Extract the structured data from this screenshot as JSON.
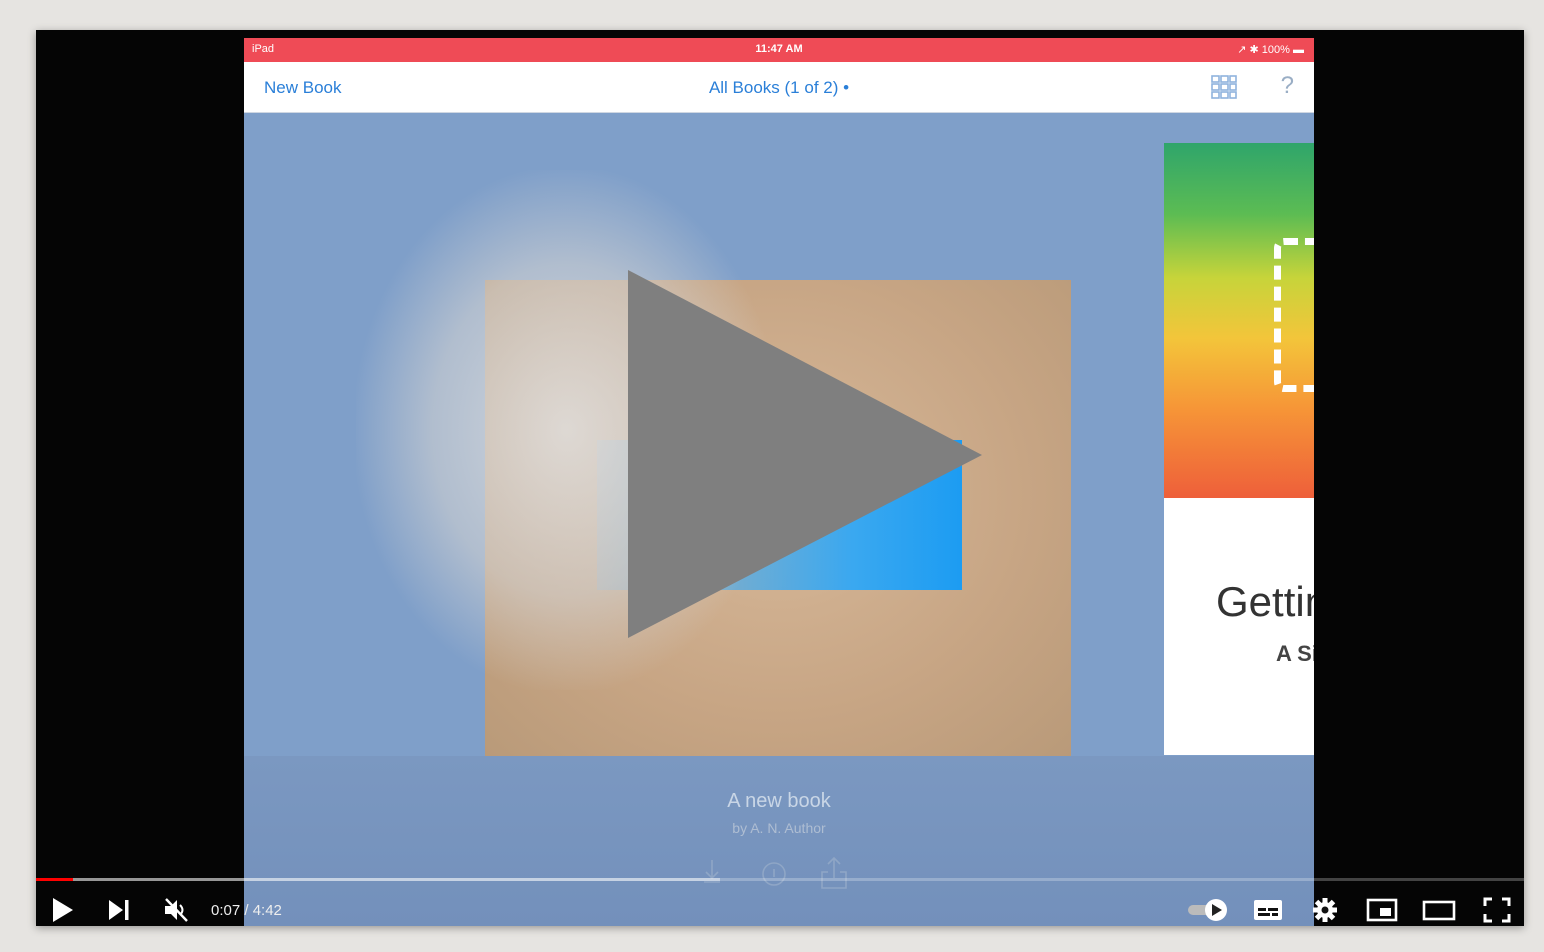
{
  "ipad": {
    "status_left": "iPad",
    "status_time": "11:47 AM",
    "status_right": "↗ ✱ 100% ▬"
  },
  "nav": {
    "new_book": "New Book",
    "all_books": "All Books (1 of 2) •",
    "help": "?"
  },
  "book": {
    "title": "A new book",
    "author": "by A. N. Author"
  },
  "side_book": {
    "title": "Gettin",
    "subtitle": "A Si"
  },
  "player": {
    "time": "0:07 / 4:42",
    "progress_fraction": 0.025,
    "buffered_fraction": 0.46,
    "accent": "#ff0000"
  },
  "icons": [
    "play-icon",
    "next-icon",
    "mute-icon",
    "autoplay-toggle-icon",
    "subtitles-icon",
    "settings-icon",
    "miniplayer-icon",
    "theater-icon",
    "fullscreen-icon",
    "grid-icon",
    "help-icon",
    "big-play-icon"
  ]
}
